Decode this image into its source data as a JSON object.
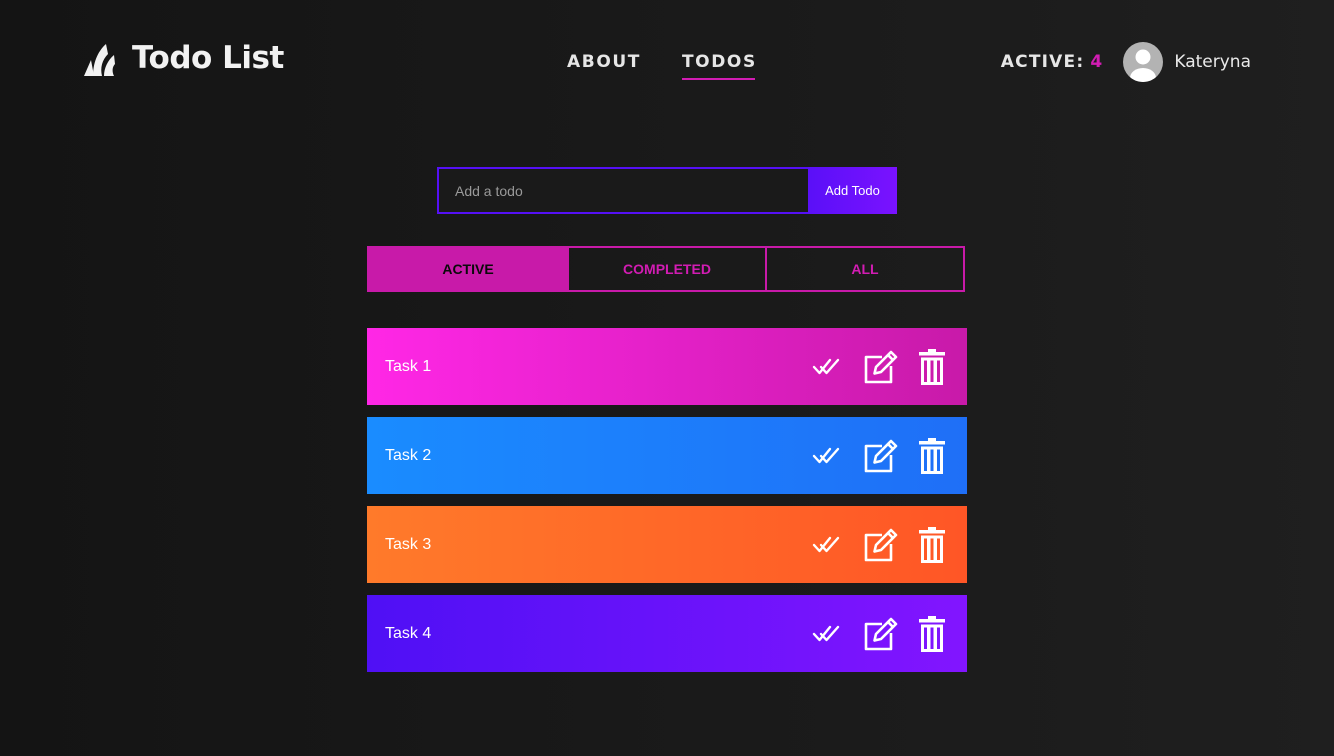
{
  "header": {
    "logo": {
      "icon": "logo-mark-icon",
      "title": "Todo List"
    },
    "nav": [
      {
        "label": "ABOUT",
        "active": false
      },
      {
        "label": "TODOS",
        "active": true
      }
    ],
    "active_label": "ACTIVE:",
    "active_count": "4",
    "avatar_icon": "user-avatar-icon",
    "username": "Kateryna"
  },
  "add_form": {
    "placeholder": "Add a todo",
    "value": "",
    "button_label": "Add Todo"
  },
  "filters": [
    {
      "label": "ACTIVE",
      "selected": true
    },
    {
      "label": "COMPLETED",
      "selected": false
    },
    {
      "label": "ALL",
      "selected": false
    }
  ],
  "todos": [
    {
      "title": "Task 1",
      "colors": [
        "#ff27e6",
        "#c81aa9"
      ]
    },
    {
      "title": "Task 2",
      "colors": [
        "#1a8cff",
        "#1f6ff7"
      ]
    },
    {
      "title": "Task 3",
      "colors": [
        "#ff7a2a",
        "#ff5626"
      ]
    },
    {
      "title": "Task 4",
      "colors": [
        "#4f10f5",
        "#8215ff"
      ]
    }
  ],
  "icons": {
    "complete": "double-check-icon",
    "edit": "edit-icon",
    "delete": "trash-icon"
  },
  "colors": {
    "accent": "#d21cb3",
    "button": "#5a10f8"
  }
}
